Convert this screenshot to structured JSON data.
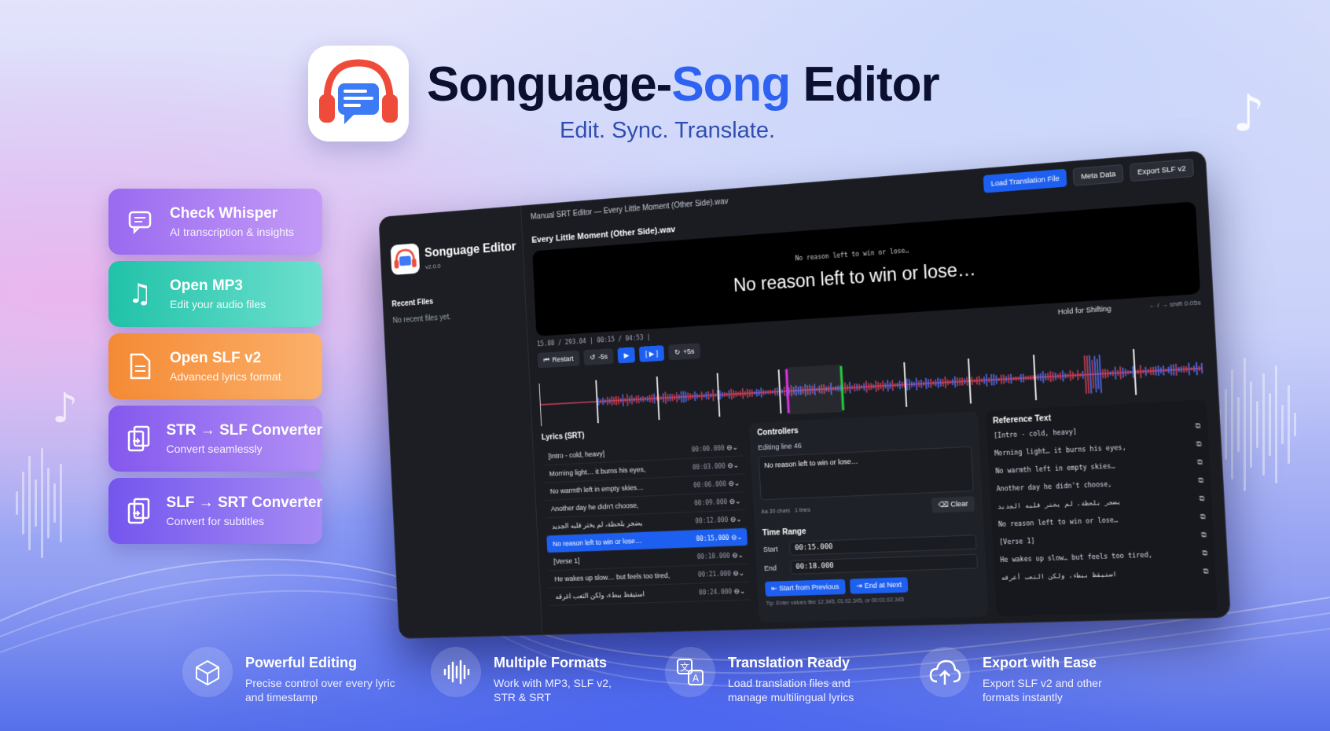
{
  "header": {
    "title_main": "Songuage-",
    "title_accent": "Song",
    "title_end": " Editor",
    "tagline": "Edit. Sync. Translate."
  },
  "features": [
    {
      "title": "Check Whisper",
      "subtitle": "AI transcription & insights",
      "icon": "chat-icon",
      "color": "#9b6cf0"
    },
    {
      "title": "Open MP3",
      "subtitle": "Edit your audio files",
      "icon": "music-note-icon",
      "color": "#2ec4b6"
    },
    {
      "title": "Open SLF v2",
      "subtitle": "Advanced lyrics format",
      "icon": "document-icon",
      "color": "#f58a3c"
    },
    {
      "title": "STR → SLF Converter",
      "subtitle": "Convert seamlessly",
      "icon": "convert-icon",
      "color": "#8a5cf0"
    },
    {
      "title": "SLF → SRT Converter",
      "subtitle": "Convert for subtitles",
      "icon": "convert-icon",
      "color": "#7a5cf0"
    }
  ],
  "window": {
    "title": "Manual SRT Editor — Every Little Moment (Other Side).wav",
    "buttons": {
      "load_translation": "Load Translation File",
      "meta_data": "Meta Data",
      "export": "Export SLF v2"
    },
    "sidebar": {
      "app_name": "Songuage Editor",
      "version": "v2.0.0",
      "recent_title": "Recent Files",
      "recent_empty": "No recent files yet."
    },
    "filename": "Every Little Moment (Other Side).wav",
    "player": {
      "small_line": "No reason left to win or lose…",
      "big_line": "No reason left to win or lose…"
    },
    "time_info": "15.88 / 293.04 | 00:15 / 04:53 |",
    "hold_label": "Hold for Shifting",
    "shift_hint": "← / → shift 0.05s",
    "controls": {
      "restart": "Restart",
      "back": "-5s",
      "forward": "+5s",
      "bracket": "[ ▶ ]"
    },
    "lyrics_title": "Lyrics (SRT)",
    "lyrics": [
      {
        "text": "[Intro - cold, heavy]",
        "time": "00:00.000"
      },
      {
        "text": "Morning light… it burns his eyes,",
        "time": "00:03.000"
      },
      {
        "text": "No warmth left in empty skies…",
        "time": "00:06.000"
      },
      {
        "text": "Another day he didn't choose,",
        "time": "00:09.000"
      },
      {
        "text": "يضجر بلحظة، لم يختر قلبه الجديد",
        "time": "00:12.000"
      },
      {
        "text": "No reason left to win or lose…",
        "time": "00:15.000"
      },
      {
        "text": "[Verse 1]",
        "time": "00:18.000"
      },
      {
        "text": "He wakes up slow… but feels too tired,",
        "time": "00:21.000"
      },
      {
        "text": "استيقظ ببطء، ولكن التعب أغرقه",
        "time": "00:24.000"
      }
    ],
    "selected_index": 5,
    "controllers": {
      "title": "Controllers",
      "editing": "Editing line 46",
      "text": "No reason left to win or lose…",
      "chars": "Aa  30 chars",
      "lines": "1 lines",
      "clear": "Clear",
      "time_range_title": "Time Range",
      "start_label": "Start",
      "start_value": "00:15.000",
      "end_label": "End",
      "end_value": "00:18.000",
      "start_prev": "Start from Previous",
      "end_next": "End at Next",
      "tip": "Tip: Enter values like 12.345, 01:02.345, or 00:01:02.345"
    },
    "reference_title": "Reference Text",
    "reference": [
      "[Intro - cold, heavy]",
      "Morning light… it burns his eyes,",
      "No warmth left in empty skies…",
      "Another day he didn't choose,",
      "يضجر بلحظة، لم يختر قلبه الجديد",
      "No reason left to win or lose…",
      "[Verse 1]",
      "He wakes up slow… but feels too tired,",
      "استيقظ ببطء، ولكن التعب أغرقه"
    ]
  },
  "bottom_features": [
    {
      "title": "Powerful Editing",
      "desc": "Precise control over every lyric and timestamp",
      "icon": "cube-sparkle-icon"
    },
    {
      "title": "Multiple Formats",
      "desc": "Work with MP3, SLF v2, STR & SRT",
      "icon": "audio-wave-icon"
    },
    {
      "title": "Translation Ready",
      "desc": "Load translation files and manage multilingual lyrics",
      "icon": "translate-icon"
    },
    {
      "title": "Export with Ease",
      "desc": "Export SLF v2 and other formats instantly",
      "icon": "cloud-upload-icon"
    }
  ]
}
